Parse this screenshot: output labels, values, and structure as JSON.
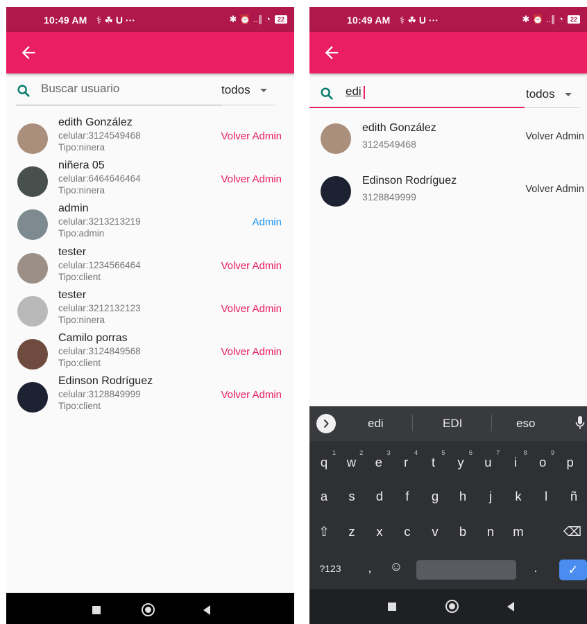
{
  "status_bar": {
    "time": "10:49 AM",
    "notification_glyphs": "⚕ ☘ U ···",
    "right_glyphs": "✱ ⏰ ..∥ ◔",
    "battery": "22"
  },
  "left_screen": {
    "search_placeholder": "Buscar usuario",
    "filter_value": "todos",
    "users": [
      {
        "name": "edith González",
        "phone": "celular:3124549468",
        "type": "Tipo:ninera",
        "action": "Volver Admin",
        "avatar_color": "#a98f7c"
      },
      {
        "name": "niñera 05",
        "phone": "celular:6464646464",
        "type": "Tipo:ninera",
        "action": "Volver Admin",
        "avatar_color": "#47504d"
      },
      {
        "name": "admin",
        "phone": "celular:3213213219",
        "type": "Tipo:admin",
        "action": "Admin",
        "avatar_color": "#7d8a8f"
      },
      {
        "name": "tester",
        "phone": "celular:1234566464",
        "type": "Tipo:client",
        "action": "Volver Admin",
        "avatar_color": "#9c8f86"
      },
      {
        "name": "tester",
        "phone": "celular:3212132123",
        "type": "Tipo:ninera",
        "action": "Volver Admin",
        "avatar_color": "#b9b9b9"
      },
      {
        "name": "Camilo porras",
        "phone": "celular:3124849568",
        "type": "Tipo:client",
        "action": "Volver Admin",
        "avatar_color": "#6e4b3e"
      },
      {
        "name": "Edinson Rodríguez",
        "phone": "celular:3128849999",
        "type": "Tipo:client",
        "action": "Volver Admin",
        "avatar_color": "#1d2232"
      }
    ]
  },
  "right_screen": {
    "search_value": "edi",
    "filter_value": "todos",
    "results": [
      {
        "name": "edith González",
        "phone": "3124549468",
        "action": "Volver Admin",
        "avatar_color": "#a98f7c"
      },
      {
        "name": "Edinson Rodríguez",
        "phone": "3128849999",
        "action": "Volver Admin",
        "avatar_color": "#1d2232"
      }
    ],
    "keyboard": {
      "suggestions": [
        "edi",
        "EDI",
        "eso"
      ],
      "row1": [
        {
          "k": "q",
          "n": "1"
        },
        {
          "k": "w",
          "n": "2"
        },
        {
          "k": "e",
          "n": "3"
        },
        {
          "k": "r",
          "n": "4"
        },
        {
          "k": "t",
          "n": "5"
        },
        {
          "k": "y",
          "n": "6"
        },
        {
          "k": "u",
          "n": "7"
        },
        {
          "k": "i",
          "n": "8"
        },
        {
          "k": "o",
          "n": "9"
        },
        {
          "k": "p",
          "n": ""
        }
      ],
      "row2": [
        "a",
        "s",
        "d",
        "f",
        "g",
        "h",
        "j",
        "k",
        "l",
        "ñ"
      ],
      "row3": [
        "⇧",
        "z",
        "x",
        "c",
        "v",
        "b",
        "n",
        "m",
        "⌫"
      ],
      "row4": {
        "symbols": "?123",
        "comma": ",",
        "emoji": "☺",
        "period": ".",
        "enter": "✓"
      }
    }
  },
  "colors": {
    "accent": "#e91e63",
    "status_bar": "#b0174a",
    "admin_link": "#2196f3",
    "keyboard_bg": "#2f3034"
  }
}
